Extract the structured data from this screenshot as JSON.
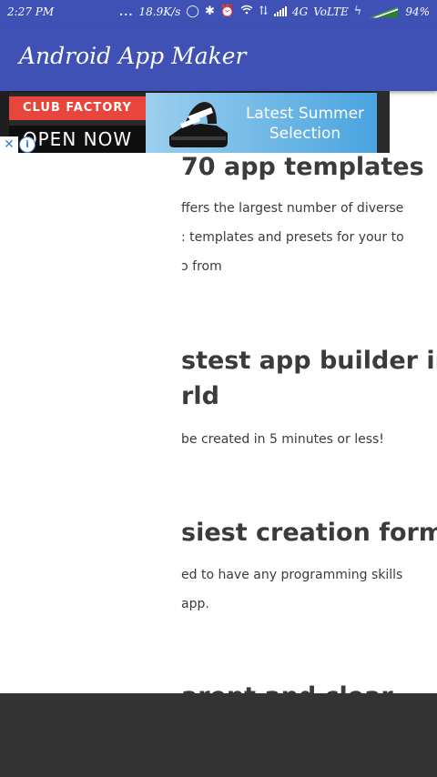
{
  "status_bar": {
    "time": "2:27 PM",
    "dots": "...",
    "network_speed": "18.9K/s",
    "network_type": "4G",
    "volte": "VoLTE",
    "battery": "94%",
    "icons": [
      "ring-icon",
      "bluetooth-icon",
      "alarm-icon",
      "wifi-icon",
      "data-arrows-icon",
      "signal-icon",
      "charging-icon",
      "battery-icon"
    ]
  },
  "toolbar": {
    "title": "Android App Maker",
    "color": "#3f51b5"
  },
  "ad": {
    "brand": "CLUB FACTORY",
    "cta": "OPEN NOW",
    "headline_line1": "Latest Summer",
    "headline_line2": "Selection",
    "close_glyph": "✕",
    "info_glyph": "i"
  },
  "content": {
    "sections": [
      {
        "heading_lines": [
          "70 app templates"
        ],
        "body_lines": [
          "ffers the largest number of diverse",
          ": templates and presets for your to",
          "ɔ from"
        ]
      },
      {
        "heading_lines": [
          "stest app builder in",
          "rld"
        ],
        "body_lines": [
          "be created in 5 minutes or less!"
        ]
      },
      {
        "heading_lines": [
          "siest creation form"
        ],
        "body_lines": [
          "ed to have any programming skills",
          "app."
        ]
      },
      {
        "heading_lines": [
          "arent and clear"
        ],
        "body_lines": []
      }
    ]
  }
}
